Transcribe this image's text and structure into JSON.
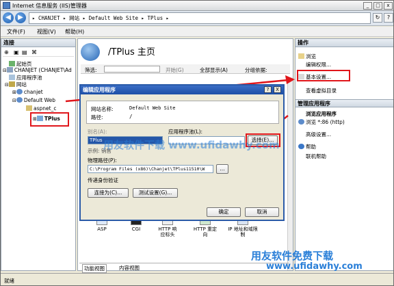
{
  "window": {
    "title": "Internet 信息服务 (IIS)管理器"
  },
  "address": {
    "path": "▸ CHANJET ▸ 网站 ▸ Default Web Site ▸ TPlus ▸"
  },
  "menu": [
    "文件(F)",
    "视图(V)",
    "帮助(H)"
  ],
  "connections": {
    "header": "连接",
    "tree": [
      "起始页",
      "CHANJET (CHANJET\\Ad",
      "应用程序池",
      "网站",
      "chanjet",
      "Default Web",
      "aspnet_c",
      "TPlus"
    ]
  },
  "center": {
    "title": "/TPlus 主页",
    "filter_label": "筛选:",
    "start_label": "开始(G)",
    "show_all_label": "全部显示(A)",
    "group_label": "分组依据:",
    "section": "",
    "features": [
      "ASP",
      "CGI",
      "HTTP 响应标头",
      "HTTP 重定向",
      "IP 地址和域限制"
    ],
    "tab_features": "功能视图",
    "tab_content": "内容视图"
  },
  "actions": {
    "header": "操作",
    "items": [
      "浏览",
      "编辑权限...",
      "基本设置...",
      "查看虚拟目录"
    ],
    "section2": "管理应用程序",
    "browse_app": "浏览应用程序",
    "browse_port": "浏览 *:86 (http)",
    "advanced": "高级设置...",
    "help": "帮助",
    "online_help": "联机帮助"
  },
  "dialog": {
    "title": "编辑应用程序",
    "help_btn": "?",
    "close_btn": "X",
    "site_label": "网站名称:",
    "site_value": "Default Web Site",
    "path_label": "路径:",
    "path_value": "/",
    "alias_label": "别名(A):",
    "alias_value": "TPlus",
    "pool_label": "应用程序池(L):",
    "pool_value": "",
    "select_btn": "选择(E)...",
    "example_text": "示例: 销售",
    "physical_label": "物理路径(P):",
    "physical_value": "C:\\Program Files (x86)\\Chanjet\\TPlus11510\\W",
    "browse_btn": "...",
    "auth_label": "传递身份验证",
    "connect_btn": "连接为(C)...",
    "test_btn": "测试设置(G)...",
    "ok_btn": "确定",
    "cancel_btn": "取消"
  },
  "watermarks": {
    "middle": "用友软件下载 www.ufidawhy.com",
    "bottom_cn": "用友软件免费下载",
    "bottom_url": "www.ufidawhy.com"
  },
  "status": {
    "text": "就绪"
  },
  "colors": {
    "annotation_red": "#e0151a",
    "dialog_blue": "#2a5aa8",
    "watermark_blue": "#2a7fd8"
  }
}
